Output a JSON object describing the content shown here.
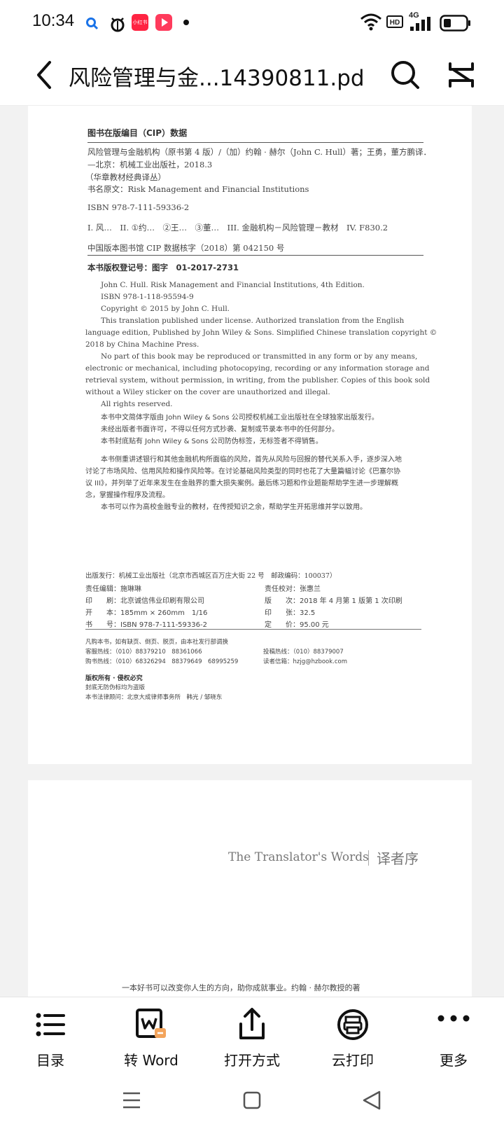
{
  "status_bar": {
    "time": "10:34",
    "app_icons": [
      "search-icon",
      "bug-icon",
      "xiaohongshu-icon",
      "video-play-icon",
      "dot-icon"
    ],
    "app_badge": "小红书",
    "network": "4G",
    "hd": "HD"
  },
  "header": {
    "title": "风险管理与金...14390811.pdf",
    "icons": [
      "back-icon",
      "search-icon",
      "expand-icon"
    ]
  },
  "page1": {
    "cip_heading": "图书在版编目（CIP）数据",
    "cip_line1": "风险管理与金融机构（原书第 4 版）/（加）约翰 · 赫尔（John C. Hull）著；王勇，董方鹏译．",
    "cip_line2": "—北京：机械工业出版社，2018.3",
    "cip_line3": "（华章教材经典译丛）",
    "cip_line4": "书名原文：Risk Management and Financial Institutions",
    "isbn": "ISBN 978-7-111-59336-2",
    "classification": "I. 风…　II. ①约…　②王…　③董…　III. 金融机构－风险管理－教材　IV. F830.2",
    "cip_number": "中国版本图书馆 CIP 数据核字（2018）第 042150 号",
    "copyright_reg": "本书版权登记号：图字　01-2017-2731",
    "english_text": [
      "John C. Hull. Risk Management and Financial Institutions, 4th Edition.",
      "ISBN 978-1-118-95594-9",
      "Copyright © 2015 by John C. Hull.",
      "This translation published under license. Authorized translation from the English",
      "language edition, Published by John Wiley & Sons. Simplified Chinese translation copyright ©",
      "2018 by China Machine Press.",
      "No part of this book may be reproduced or transmitted in any form or by any means,",
      "electronic or mechanical, including photocopying, recording or any information storage and",
      "retrieval system, without permission, in writing, from the publisher. Copies of this book sold",
      "without a Wiley sticker on the cover are unauthorized and illegal.",
      "All rights reserved."
    ],
    "chinese_notices": [
      "本书中文简体字版由 John Wiley & Sons 公司授权机械工业出版社在全球独家出版发行。",
      "未经出版者书面许可，不得以任何方式抄袭、复制或节录本书中的任何部分。",
      "本书封底贴有 John Wiley & Sons 公司防伪标签，无标签者不得销售。"
    ],
    "summary": [
      "本书侧重讲述银行和其他金融机构所面临的风险，首先从风险与回报的替代关系入手，逐步深入地",
      "讨论了市场风险、信用风险和操作风险等。在讨论基础风险类型的同时也花了大量篇幅讨论《巴塞尔协",
      "议 III》，并列举了近年来发生在金融界的重大损失案例。最后练习题和作业题能帮助学生进一步理解概",
      "念，掌握操作程序及流程。",
      "本书可以作为高校金融专业的教材，在传授知识之余，帮助学生开拓思维并学以致用。"
    ],
    "publisher_line": "出版发行：机械工业出版社（北京市西城区百万庄大街 22 号　邮政编码：100037）",
    "details_left": [
      "责任编辑：施琳琳",
      "印　　刷：北京诚信伟业印刷有限公司",
      "开　　本：185mm × 260mm　1/16",
      "书　　号：ISBN 978-7-111-59336-2"
    ],
    "details_right": [
      "责任校对：张惠兰",
      "版　　次：2018 年 4 月第 1 版第 1 次印刷",
      "印　　张：32.5",
      "定　　价：95.00 元"
    ],
    "contact_left": [
      "凡购本书，如有缺页、倒页、脱页，由本社发行部调换",
      "客服热线：（010）88379210　88361066",
      "购书热线：（010）68326294　88379649　68995259"
    ],
    "contact_right": [
      "投稿热线：（010）88379007",
      "读者信箱：hzjg@hzbook.com"
    ],
    "rights_heading": "版权所有 · 侵权必究",
    "rights_lines": [
      "封底无防伪标均为盗版",
      "本书法律顾问：北京大成律师事务所　韩光 / 邹晓东"
    ]
  },
  "page2": {
    "heading_en": "The Translator's Words",
    "heading_zh": "译者序",
    "partial_line": "一本好书可以改变你人生的方向，助你成就事业。约翰 · 赫尔教授的著"
  },
  "bottom_toolbar": {
    "items": [
      {
        "label": "目录",
        "icon": "list-icon"
      },
      {
        "label": "转 Word",
        "icon": "word-convert-icon"
      },
      {
        "label": "打开方式",
        "icon": "share-icon"
      },
      {
        "label": "云打印",
        "icon": "printer-icon"
      },
      {
        "label": "更多",
        "icon": "more-icon"
      }
    ]
  },
  "nav_bar": {
    "icons": [
      "menu-nav-icon",
      "home-nav-icon",
      "back-nav-icon"
    ]
  }
}
